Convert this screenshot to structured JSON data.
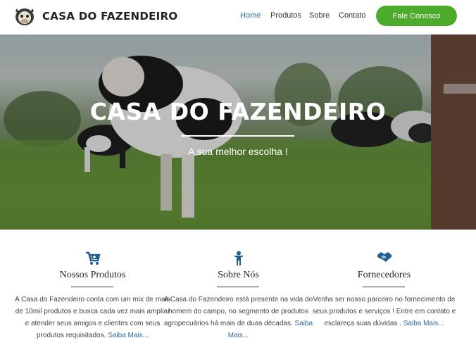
{
  "header": {
    "brand": "CASA DO FAZENDEIRO",
    "nav": [
      "Home",
      "Produtos",
      "Sobre",
      "Contato"
    ],
    "cta": "Fale Conosco"
  },
  "hero": {
    "title": "CASA DO FAZENDEIRO",
    "subtitle": "A sua melhor escolha !"
  },
  "features": [
    {
      "title": "Nossos Produtos",
      "text": "A Casa do Fazendeiro conta com um mix de mais de 10mil produtos e busca cada vez mais ampliar e atender seus amigos e clientes com seus produtos requisitados.",
      "link": "Saiba Mais..."
    },
    {
      "title": "Sobre Nós",
      "text": "A Casa do Fazendeiro está presente na vida do homem do campo, no segmento de produtos agropecuários há mais de duas décadas.",
      "link": "Saiba Mais..."
    },
    {
      "title": "Fornecedores",
      "text": "Venha ser nosso parceiro no fornecimento de seus produtos e serviços ! Entre em contato e esclareça suas dúvidas .",
      "link": "Saiba Mais..."
    }
  ],
  "colors": {
    "accent": "#4caa2d",
    "link": "#2d6aa3",
    "icon": "#1f5f8e"
  }
}
